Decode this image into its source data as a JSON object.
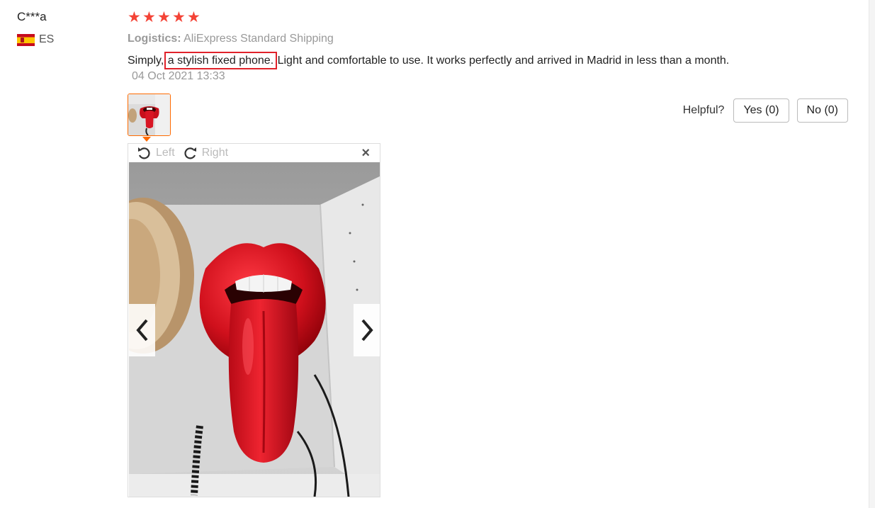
{
  "review": {
    "user_name": "C***a",
    "country_code": "ES",
    "rating": 5,
    "logistics_label": "Logistics:",
    "logistics_value": "AliExpress Standard Shipping",
    "text_before": "Simply,",
    "text_highlight": "a stylish fixed phone.",
    "text_after": "Light and comfortable to use. It works perfectly and arrived in Madrid in less than a month.",
    "date": "04 Oct 2021 13:33"
  },
  "helpful": {
    "label": "Helpful?",
    "yes_label": "Yes (0)",
    "no_label": "No (0)"
  },
  "viewer": {
    "rotate_left_label": "Left",
    "rotate_right_label": "Right",
    "close_symbol": "×"
  },
  "icons": {
    "star": "star-icon",
    "flag": "spain-flag-icon",
    "rotate_left": "rotate-left-icon",
    "rotate_right": "rotate-right-icon",
    "close": "close-icon",
    "prev": "chevron-left-icon",
    "next": "chevron-right-icon"
  },
  "colors": {
    "star": "#f44336",
    "highlight_box": "#e0222a",
    "thumb_border": "#ff6a00",
    "muted_text": "#999999"
  }
}
